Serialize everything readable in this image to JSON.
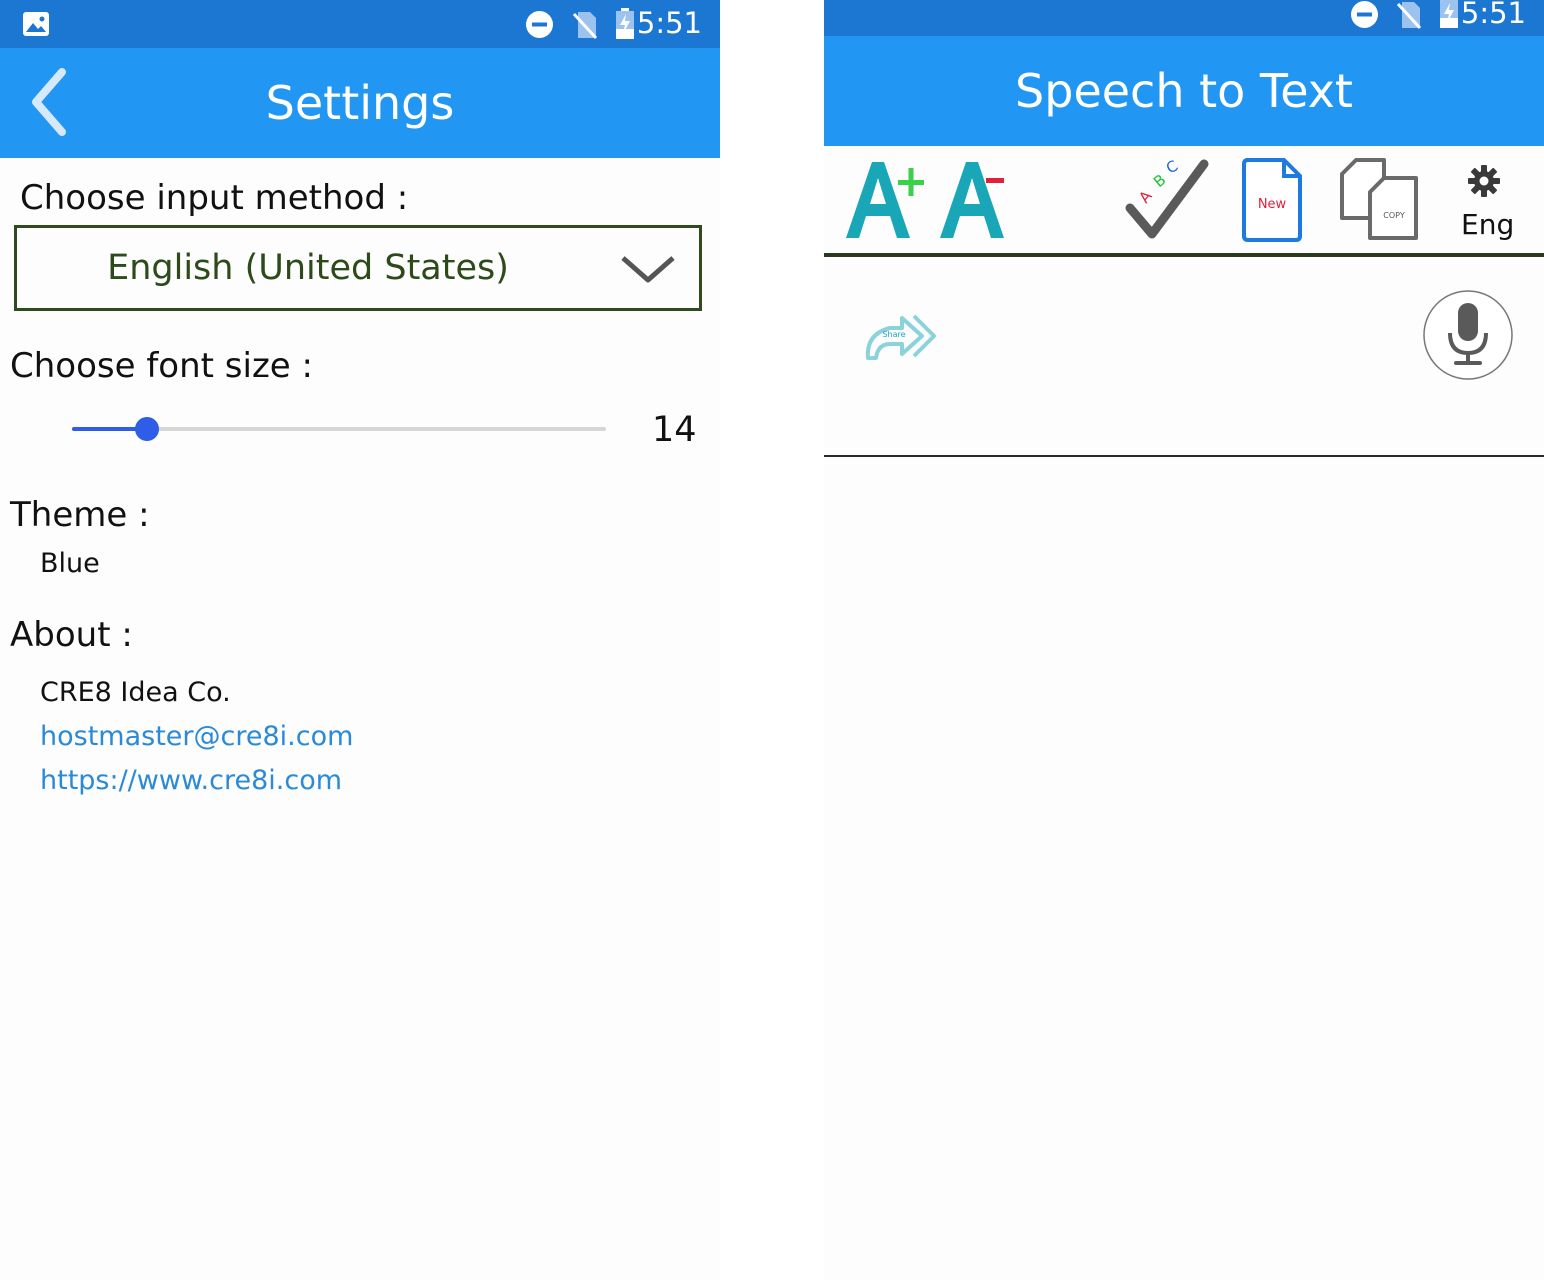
{
  "status_bar": {
    "time": "5:51"
  },
  "settings": {
    "title": "Settings",
    "input_method_label": "Choose input method :",
    "input_method_value": "English (United States)",
    "font_size_label": "Choose font size :",
    "font_size_value": "14",
    "font_size_fraction": 0.14,
    "theme_label": "Theme :",
    "theme_value": "Blue",
    "about_label": "About :",
    "about_company": "CRE8 Idea Co.",
    "about_email": "hostmaster@cre8i.com",
    "about_url": "https://www.cre8i.com"
  },
  "speech": {
    "title": "Speech to Text",
    "toolbar": {
      "new_label": "New",
      "copy_label": "COPY",
      "lang_label": "Eng",
      "abc_label": "ABC"
    },
    "share_label": "Share"
  },
  "colors": {
    "status_bar": "#1b77d2",
    "app_bar": "#2196f3",
    "slider": "#2e5de8",
    "link": "#2a8ad8",
    "teal_icon": "#19a7b8"
  },
  "icons": [
    "image-icon",
    "dnd-icon",
    "no-sim-icon",
    "battery-charging-icon",
    "back-chevron-icon",
    "chevron-down-icon",
    "font-increase-icon",
    "font-decrease-icon",
    "spellcheck-icon",
    "new-document-icon",
    "copy-icon",
    "gear-icon",
    "share-icon",
    "microphone-icon"
  ]
}
